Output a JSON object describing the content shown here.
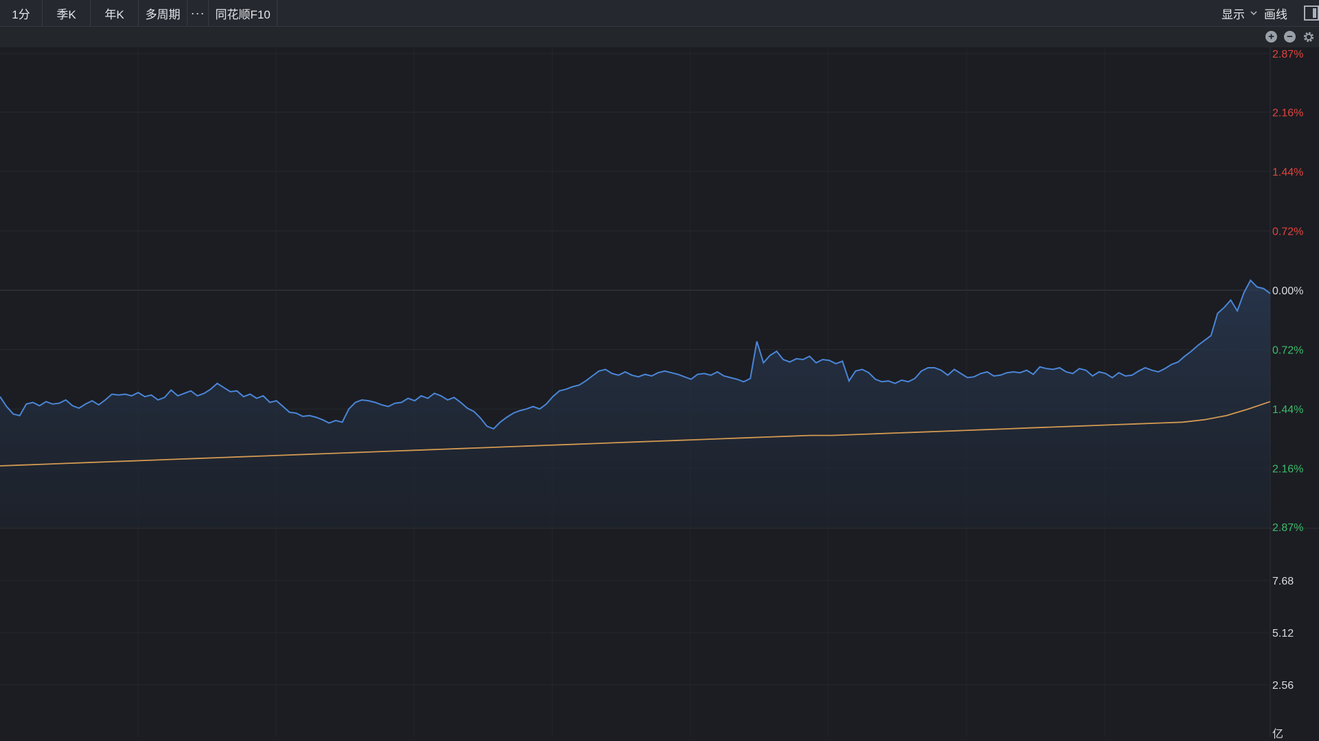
{
  "tabs": [
    {
      "label": "1分"
    },
    {
      "label": "季K"
    },
    {
      "label": "年K"
    },
    {
      "label": "多周期"
    },
    {
      "label": "···"
    },
    {
      "label": "同花顺F10"
    }
  ],
  "toolbar": {
    "display_label": "显示",
    "draw_label": "画线"
  },
  "icons": [
    "plus-circle-icon",
    "minus-circle-icon",
    "gear-icon",
    "layout-panel-icon",
    "chevron-down-icon"
  ],
  "colors": {
    "price_line": "#4a86d8",
    "avg_line": "#d49a52",
    "up_label": "#e0443e",
    "down_label": "#3dbb6a",
    "flat_label": "#d9dbe0"
  },
  "chart_data": [
    {
      "type": "line",
      "description_axis": "percent change (intraday)",
      "y_axis_labels": [
        {
          "text": "2.87%",
          "value": 2.87,
          "tone": "up"
        },
        {
          "text": "2.16%",
          "value": 2.16,
          "tone": "up"
        },
        {
          "text": "1.44%",
          "value": 1.44,
          "tone": "up"
        },
        {
          "text": "0.72%",
          "value": 0.72,
          "tone": "up"
        },
        {
          "text": "0.00%",
          "value": 0.0,
          "tone": "flat"
        },
        {
          "text": "0.72%",
          "value": -0.72,
          "tone": "down"
        },
        {
          "text": "1.44%",
          "value": -1.44,
          "tone": "down"
        },
        {
          "text": "2.16%",
          "value": -2.16,
          "tone": "down"
        },
        {
          "text": "2.87%",
          "value": -2.87,
          "tone": "down"
        }
      ],
      "ylim": [
        -2.87,
        2.87
      ],
      "grid": true,
      "series": [
        {
          "role": "price",
          "values": [
            -1.29,
            -1.41,
            -1.5,
            -1.52,
            -1.38,
            -1.36,
            -1.4,
            -1.35,
            -1.38,
            -1.37,
            -1.33,
            -1.4,
            -1.43,
            -1.38,
            -1.34,
            -1.39,
            -1.33,
            -1.26,
            -1.27,
            -1.26,
            -1.28,
            -1.24,
            -1.29,
            -1.27,
            -1.33,
            -1.3,
            -1.21,
            -1.28,
            -1.25,
            -1.22,
            -1.28,
            -1.25,
            -1.2,
            -1.13,
            -1.18,
            -1.23,
            -1.22,
            -1.29,
            -1.26,
            -1.31,
            -1.28,
            -1.36,
            -1.34,
            -1.41,
            -1.48,
            -1.49,
            -1.53,
            -1.52,
            -1.54,
            -1.57,
            -1.61,
            -1.58,
            -1.6,
            -1.44,
            -1.36,
            -1.33,
            -1.34,
            -1.36,
            -1.39,
            -1.41,
            -1.37,
            -1.36,
            -1.31,
            -1.34,
            -1.28,
            -1.31,
            -1.25,
            -1.28,
            -1.33,
            -1.3,
            -1.36,
            -1.43,
            -1.47,
            -1.55,
            -1.65,
            -1.68,
            -1.6,
            -1.54,
            -1.49,
            -1.46,
            -1.44,
            -1.41,
            -1.44,
            -1.38,
            -1.29,
            -1.22,
            -1.2,
            -1.17,
            -1.15,
            -1.1,
            -1.04,
            -0.98,
            -0.96,
            -1.01,
            -1.03,
            -0.99,
            -1.03,
            -1.05,
            -1.02,
            -1.04,
            -1.0,
            -0.98,
            -1.0,
            -1.02,
            -1.05,
            -1.08,
            -1.02,
            -1.01,
            -1.03,
            -0.99,
            -1.04,
            -1.06,
            -1.08,
            -1.11,
            -1.07,
            -0.62,
            -0.88,
            -0.79,
            -0.74,
            -0.84,
            -0.87,
            -0.83,
            -0.84,
            -0.8,
            -0.88,
            -0.84,
            -0.85,
            -0.89,
            -0.86,
            -1.1,
            -0.98,
            -0.96,
            -1.0,
            -1.08,
            -1.11,
            -1.1,
            -1.13,
            -1.09,
            -1.11,
            -1.07,
            -0.98,
            -0.94,
            -0.94,
            -0.97,
            -1.03,
            -0.96,
            -1.01,
            -1.06,
            -1.05,
            -1.01,
            -0.99,
            -1.04,
            -1.03,
            -1.0,
            -0.99,
            -1.0,
            -0.97,
            -1.02,
            -0.93,
            -0.95,
            -0.96,
            -0.94,
            -0.99,
            -1.01,
            -0.95,
            -0.97,
            -1.04,
            -0.99,
            -1.01,
            -1.06,
            -1.0,
            -1.04,
            -1.03,
            -0.98,
            -0.94,
            -0.97,
            -0.99,
            -0.95,
            -0.9,
            -0.87,
            -0.8,
            -0.74,
            -0.67,
            -0.61,
            -0.55,
            -0.28,
            -0.21,
            -0.12,
            -0.25,
            -0.03,
            0.12,
            0.04,
            0.02,
            -0.04
          ],
          "color": "#4a86d8"
        },
        {
          "role": "average",
          "values": [
            -2.13,
            -2.12,
            -2.11,
            -2.1,
            -2.09,
            -2.08,
            -2.07,
            -2.06,
            -2.05,
            -2.04,
            -2.03,
            -2.02,
            -2.01,
            -2.0,
            -1.99,
            -1.98,
            -1.97,
            -1.96,
            -1.95,
            -1.94,
            -1.93,
            -1.92,
            -1.91,
            -1.9,
            -1.89,
            -1.88,
            -1.87,
            -1.86,
            -1.85,
            -1.84,
            -1.83,
            -1.82,
            -1.81,
            -1.8,
            -1.79,
            -1.78,
            -1.77,
            -1.76,
            -1.76,
            -1.75,
            -1.74,
            -1.73,
            -1.72,
            -1.71,
            -1.7,
            -1.69,
            -1.68,
            -1.67,
            -1.66,
            -1.65,
            -1.64,
            -1.63,
            -1.62,
            -1.61,
            -1.6,
            -1.57,
            -1.52,
            -1.44,
            -1.35
          ],
          "color": "#d49a52"
        }
      ]
    },
    {
      "type": "bar",
      "description_axis": "volume",
      "y_axis_labels": [
        {
          "text": "7.68",
          "value": 7.68
        },
        {
          "text": "5.12",
          "value": 5.12
        },
        {
          "text": "2.56",
          "value": 2.56
        }
      ],
      "unit_label": "亿",
      "ylim": [
        0,
        10.24
      ]
    }
  ]
}
